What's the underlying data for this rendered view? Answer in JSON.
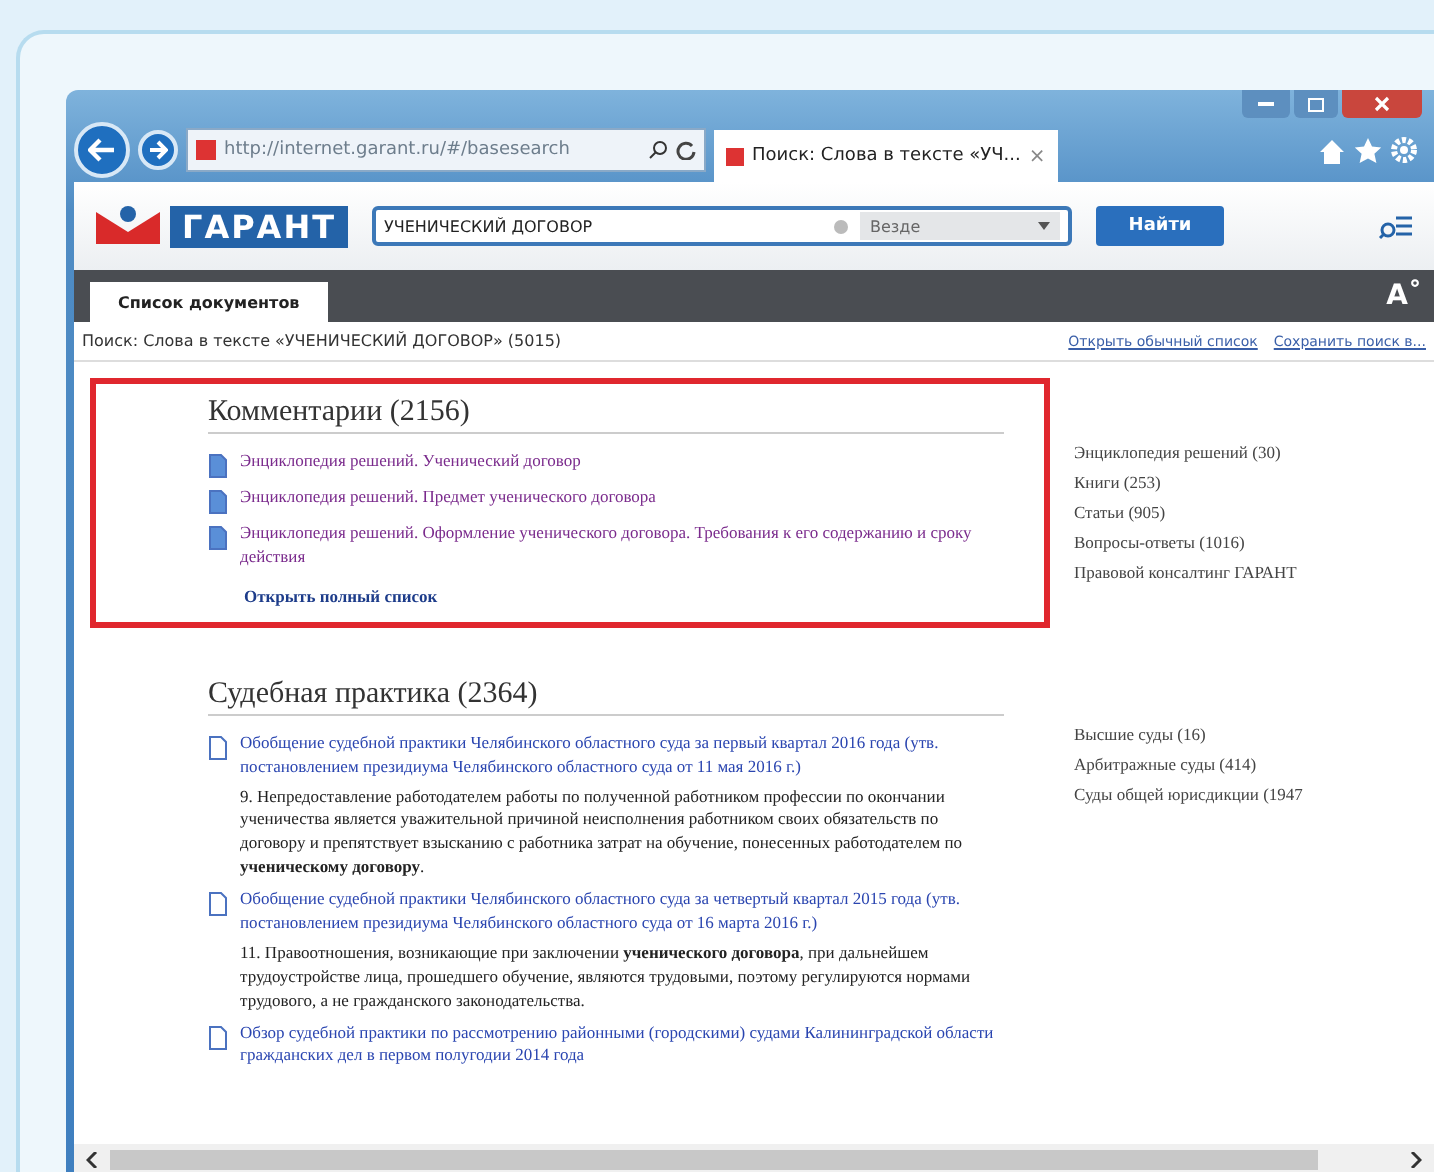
{
  "browser": {
    "address": "http://internet.garant.ru/#/basesearch",
    "tab_title": "Поиск: Слова в тексте «УЧ...",
    "tab_close": "×"
  },
  "toolbar": {
    "logo": "ГАРАНТ",
    "query": "УЧЕНИЧЕСКИЙ ДОГОВОР",
    "scope": "Везде",
    "search_button": "Найти",
    "font_button": "A˚"
  },
  "doc_tabs": [
    {
      "label": "Список документов",
      "selected": true
    }
  ],
  "breadcrumb": "Поиск: Слова в тексте «УЧЕНИЧЕСКИЙ ДОГОВОР» (5015)",
  "header_links": [
    "Открыть обычный список",
    "Сохранить поиск в..."
  ],
  "sections": [
    {
      "title": "Комментарии (2156)",
      "outlined": true,
      "items": [
        {
          "title": "Энциклопедия решений. Ученический договор"
        },
        {
          "title": "Энциклопедия решений. Предмет ученического договора"
        },
        {
          "title": "Энциклопедия решений. Оформление ученического договора. Требования к его содержанию и сроку действия"
        }
      ],
      "more_link": "Открыть полный список",
      "facets": [
        "Энциклопедия решений (30)",
        "Книги (253)",
        "Статьи (905)",
        "Вопросы-ответы (1016)",
        "Правовой консалтинг ГАРАНТ"
      ]
    },
    {
      "title": "Судебная практика (2364)",
      "outlined": false,
      "items": [
        {
          "title": "Обобщение судебной практики Челябинского областного суда за первый квартал 2016 года (утв. постановлением президиума Челябинского областного суда от 11 мая 2016 г.)",
          "snippet": "9. Непредоставление работодателем работы по полученной работником профессии по окончании ученичества является уважительной причиной неисполнения работником своих обязательств по договору и препятствует взысканию с работника затрат на обучение, понесенных работодателем по **ученическому договору**."
        },
        {
          "title": "Обобщение судебной практики Челябинского областного суда за четвертый квартал 2015 года (утв. постановлением президиума Челябинского областного суда от 16 марта 2016 г.)",
          "snippet": "11. Правоотношения, возникающие при заключении **ученического договора**, при дальнейшем трудоустройстве лица, прошедшего обучение, являются трудовыми, поэтому регулируются нормами трудового, а не гражданского законодательства."
        },
        {
          "title": "Обзор судебной практики по рассмотрению районными (городскими) судами Калининградской области гражданских дел в первом полугодии 2014 года"
        }
      ],
      "facets": [
        "Высшие суды (16)",
        "Арбитражные суды (414)",
        "Суды общей юрисдикции (1947"
      ]
    }
  ]
}
